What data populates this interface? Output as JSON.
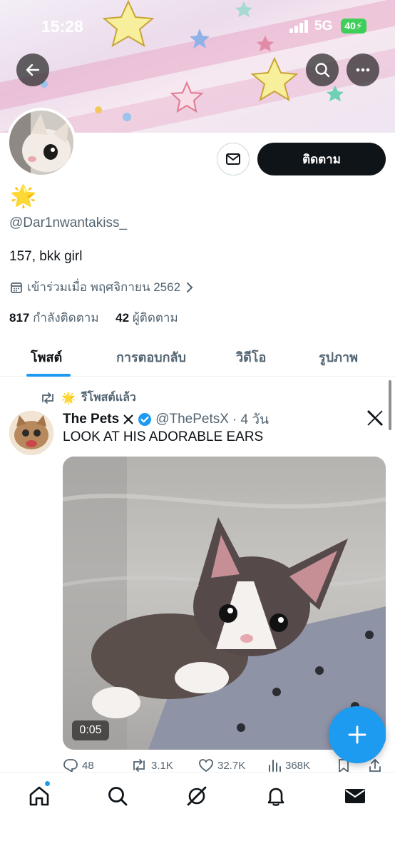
{
  "status_bar": {
    "time": "15:28",
    "network": "5G",
    "battery": "40"
  },
  "profile": {
    "name_emoji": "🌟",
    "handle": "@Dar1nwantakiss_",
    "bio": "157, bkk girl",
    "joined": "เข้าร่วมเมื่อ พฤศจิกายน 2562",
    "following_count": "817",
    "following_label": "กำลังติดตาม",
    "followers_count": "42",
    "followers_label": "ผู้ติดตาม",
    "follow_button": "ติดตาม"
  },
  "tabs": [
    "โพสต์",
    "การตอบกลับ",
    "วิดีโอ",
    "รูปภาพ"
  ],
  "post": {
    "repost_emoji": "🌟",
    "repost_label": "รีโพสต์แล้ว",
    "author_name": "The Pets",
    "author_handle": "@ThePetsX",
    "time": "· 4 วัน",
    "text": "LOOK AT HIS ADORABLE EARS",
    "video_duration": "0:05",
    "replies": "48",
    "reposts": "3.1K",
    "likes": "32.7K",
    "views": "368K"
  },
  "colors": {
    "accent": "#1d9bf0",
    "text": "#0f1419",
    "muted": "#536471",
    "follow_bg": "#0f1419"
  },
  "icons": {
    "back": "arrow-left-icon",
    "search": "search-icon",
    "more": "more-icon",
    "message": "envelope-icon",
    "calendar": "calendar-icon",
    "chevron": "chevron-right-icon",
    "verified": "verified-badge-icon",
    "home": "home-icon",
    "explore": "search-icon",
    "grok": "grok-icon",
    "notifications": "bell-icon",
    "messages": "mail-icon"
  }
}
